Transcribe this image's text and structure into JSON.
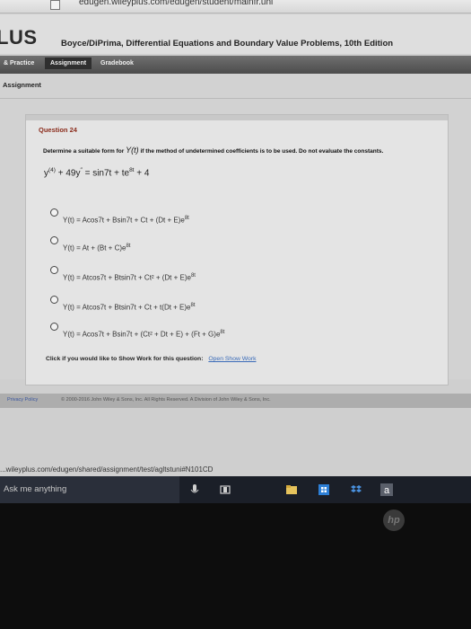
{
  "browser": {
    "url": "edugen.wileyplus.com/edugen/student/mainfr.uni"
  },
  "header": {
    "logo": "LUS",
    "book_title": "Boyce/DiPrima, Differential Equations and Boundary Value Problems, 10th Edition"
  },
  "nav": {
    "tabs": [
      "& Practice",
      "Assignment",
      "Gradebook"
    ]
  },
  "page": {
    "heading": "Assignment"
  },
  "question": {
    "label": "Question 24",
    "prompt_start": "Determine a suitable form for",
    "prompt_fn": "Y(t)",
    "prompt_end": "if the method of undetermined coefficients is to be used. Do not evaluate the constants.",
    "equation": {
      "lhs1": "y",
      "lhs1_sup": "(4)",
      "lhs2": " + 49y",
      "lhs2_sup": "″",
      "mid": " = sin7t + te",
      "mid_sup": "8t",
      "end": " + 4"
    },
    "options": [
      {
        "text": "Y(t) = Acos7t + Bsin7t + Ct + (Dt + E)e",
        "sup": "8t"
      },
      {
        "text": "Y(t) = At + (Bt + C)e",
        "sup": "8t"
      },
      {
        "text": "Y(t) = Atcos7t + Btsin7t + Ct² + (Dt + E)e",
        "sup": "8t"
      },
      {
        "text": "Y(t) = Atcos7t + Btsin7t + Ct + t(Dt + E)e",
        "sup": "8t"
      },
      {
        "text": "Y(t) = Acos7t + Bsin7t + (Ct² + Dt + E) + (Ft + G)e",
        "sup": "8t"
      }
    ]
  },
  "show_work": {
    "text": "Click if you would like to Show Work for this question:",
    "link": "Open Show Work"
  },
  "footer": {
    "privacy": "Privacy Policy",
    "copyright": "© 2000-2016 John Wiley & Sons, Inc. All Rights Reserved. A Division of John Wiley & Sons, Inc."
  },
  "status_url": "...wileyplus.com/edugen/shared/assignment/test/agltstuni#N101CD",
  "taskbar": {
    "search_placeholder": "Ask me anything"
  }
}
